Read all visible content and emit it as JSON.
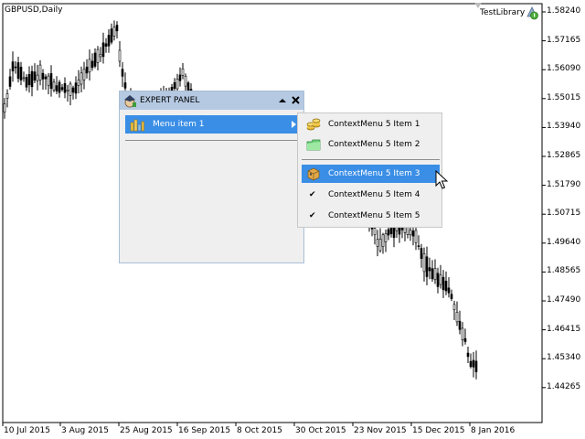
{
  "chart": {
    "symbol": "GBPUSD,Daily",
    "expert_name": "TestLibrary",
    "y_labels": [
      "1.58240",
      "1.57165",
      "1.56090",
      "1.55015",
      "1.53940",
      "1.52865",
      "1.51790",
      "1.50715",
      "1.49640",
      "1.48565",
      "1.47490",
      "1.46415",
      "1.45340",
      "1.44265"
    ],
    "x_labels": [
      "10 Jul 2015",
      "3 Aug 2015",
      "25 Aug 2015",
      "16 Sep 2015",
      "8 Oct 2015",
      "30 Oct 2015",
      "23 Nov 2015",
      "15 Dec 2015",
      "8 Jan 2016"
    ],
    "colors": {
      "candle": "#000000",
      "grid_text": "#000000",
      "last_price_line": "#000000"
    }
  },
  "panel": {
    "title": "EXPERT PANEL",
    "icon": "expert-hat-icon",
    "menu_item": {
      "label": "Menu item 1",
      "icon": "bar-chart-icon"
    },
    "colors": {
      "header": "#b5c9e2",
      "body": "#efefef",
      "selected": "#3a8ee6",
      "border": "#a9bfd6"
    }
  },
  "context_menu": {
    "items": [
      {
        "label": "ContextMenu 5 Item 1",
        "icon": "coins-icon",
        "checked": false,
        "selected": false
      },
      {
        "label": "ContextMenu 5 Item 2",
        "icon": "green-folder-icon",
        "checked": false,
        "selected": false
      },
      {
        "label": "ContextMenu 5 Item 3",
        "icon": "box-icon",
        "checked": false,
        "selected": true
      },
      {
        "label": "ContextMenu 5 Item 4",
        "icon": "check-icon",
        "checked": true,
        "selected": false
      },
      {
        "label": "ContextMenu 5 Item 5",
        "icon": "check-icon",
        "checked": true,
        "selected": false
      }
    ],
    "check_mark": "✔"
  }
}
